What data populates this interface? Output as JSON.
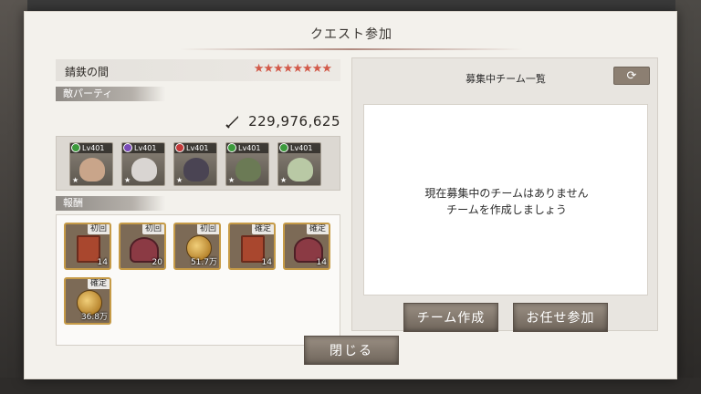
{
  "dialog": {
    "title": "クエスト参加"
  },
  "stage": {
    "name": "錆鉄の間",
    "stars_total": 8,
    "stars_filled": 8,
    "star_glyph": "★"
  },
  "enemy_section": {
    "label": "敵パーティ",
    "power": "229,976,625",
    "enemies": [
      {
        "level": "Lv401",
        "element_color": "#3c9a3c",
        "face_color": "#c9a58a"
      },
      {
        "level": "Lv401",
        "element_color": "#7a4bb8",
        "face_color": "#d9d5d2"
      },
      {
        "level": "Lv401",
        "element_color": "#c43a3a",
        "face_color": "#4a4453"
      },
      {
        "level": "Lv401",
        "element_color": "#3c9a3c",
        "face_color": "#6b7a55"
      },
      {
        "level": "Lv401",
        "element_color": "#3c9a3c",
        "face_color": "#b9c9a5"
      }
    ]
  },
  "reward_section": {
    "label": "報酬",
    "items": [
      {
        "tag": "初回",
        "qty": "14",
        "icon": "book"
      },
      {
        "tag": "初回",
        "qty": "20",
        "icon": "box"
      },
      {
        "tag": "初回",
        "qty": "51.7万",
        "icon": "coin"
      },
      {
        "tag": "確定",
        "qty": "14",
        "icon": "book"
      },
      {
        "tag": "確定",
        "qty": "14",
        "icon": "box"
      },
      {
        "tag": "確定",
        "qty": "36.8万",
        "icon": "coin"
      }
    ]
  },
  "recruit_panel": {
    "title": "募集中チーム一覧",
    "refresh_glyph": "⟳",
    "empty_line1": "現在募集中のチームはありません",
    "empty_line2": "チームを作成しましょう",
    "create_team_label": "チーム作成",
    "auto_join_label": "お任せ参加"
  },
  "close_label": "閉じる"
}
